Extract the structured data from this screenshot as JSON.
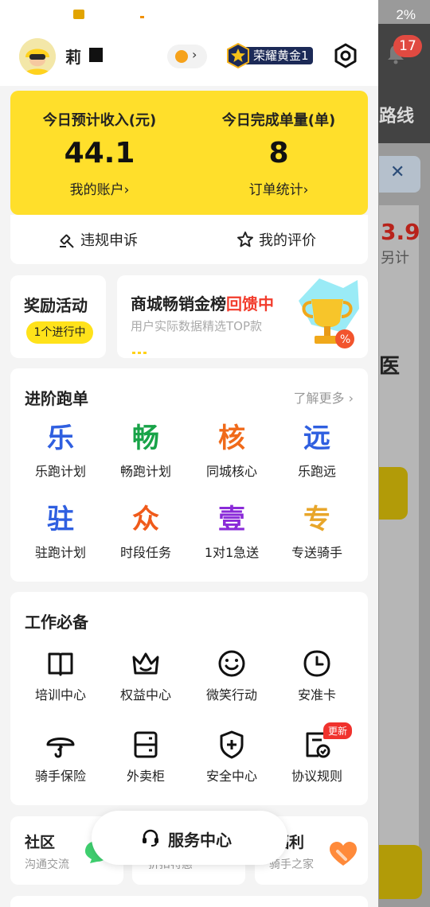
{
  "background": {
    "status_battery": "2%",
    "notification_count": "17",
    "route_label": "路线",
    "price_fragment": "3.9",
    "extra_fragment": "另计",
    "char_fragment": "医"
  },
  "profile": {
    "name_visible": "莉",
    "rank_label": "荣耀黄金1"
  },
  "income": {
    "expected_label": "今日预计收入(元)",
    "expected_value": "44.1",
    "account_link": "我的账户›",
    "orders_label": "今日完成单量(单)",
    "orders_value": "8",
    "orders_link": "订单统计›"
  },
  "actions": {
    "appeal": "违规申诉",
    "review": "我的评价"
  },
  "reward": {
    "title": "奖励活动",
    "tag": "1个进行中"
  },
  "banner": {
    "title_main": "商城畅销金榜",
    "title_highlight": "回馈中",
    "subtitle": "用户实际数据精选TOP款"
  },
  "advanced": {
    "title": "进阶跑单",
    "more": "了解更多 ›",
    "items": [
      {
        "glyph": "乐",
        "label": "乐跑计划",
        "color": "#2f5fe0"
      },
      {
        "glyph": "畅",
        "label": "畅跑计划",
        "color": "#18a348"
      },
      {
        "glyph": "核",
        "label": "同城核心",
        "color": "#f06a1a"
      },
      {
        "glyph": "远",
        "label": "乐跑远",
        "color": "#2f5fe0"
      },
      {
        "glyph": "驻",
        "label": "驻跑计划",
        "color": "#2f5fe0"
      },
      {
        "glyph": "众",
        "label": "时段任务",
        "color": "#f05a1a"
      },
      {
        "glyph": "壹",
        "label": "1对1急送",
        "color": "#8a2ad8"
      },
      {
        "glyph": "专",
        "label": "专送骑手",
        "color": "#e8a62a"
      }
    ]
  },
  "work": {
    "title": "工作必备",
    "new_badge": "更新",
    "items": [
      {
        "label": "培训中心",
        "icon": "book-icon"
      },
      {
        "label": "权益中心",
        "icon": "crown-icon"
      },
      {
        "label": "微笑行动",
        "icon": "smile-icon"
      },
      {
        "label": "安准卡",
        "icon": "clock-icon"
      },
      {
        "label": "骑手保险",
        "icon": "umbrella-icon"
      },
      {
        "label": "外卖柜",
        "icon": "cabinet-icon"
      },
      {
        "label": "安全中心",
        "icon": "shield-icon"
      },
      {
        "label": "协议规则",
        "icon": "agreement-icon"
      }
    ]
  },
  "bottom": {
    "community_title": "社区",
    "community_sub": "沟通交流",
    "mid_sub": "折扣特惠",
    "welfare_title": "福利",
    "welfare_sub": "骑手之家"
  },
  "service_center": "服务中心"
}
